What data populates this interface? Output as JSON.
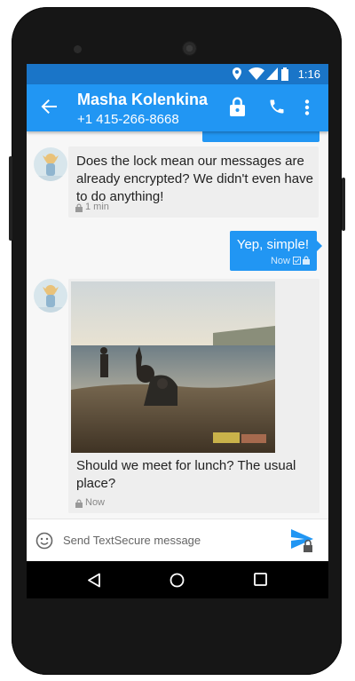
{
  "status_bar": {
    "time": "1:16"
  },
  "header": {
    "contact_name": "Masha Kolenkina",
    "phone_number": "+1 415-266-8668",
    "icons": [
      "back-arrow-icon",
      "lock-icon",
      "phone-call-icon",
      "overflow-menu-icon"
    ]
  },
  "messages": [
    {
      "direction": "incoming",
      "text": "Does the lock mean our messages are already encrypted? We didn't even have to do anything!",
      "time": "1 min"
    },
    {
      "direction": "outgoing",
      "text": "Yep, simple!",
      "time": "Now"
    },
    {
      "direction": "incoming",
      "has_image": true,
      "text": "Should we meet for lunch? The usual place?",
      "time": "Now"
    }
  ],
  "composer": {
    "placeholder": "Send TextSecure message"
  },
  "colors": {
    "primary": "#2196f3",
    "status_bar": "#1a75c8",
    "incoming_bubble": "#eeeeee"
  }
}
